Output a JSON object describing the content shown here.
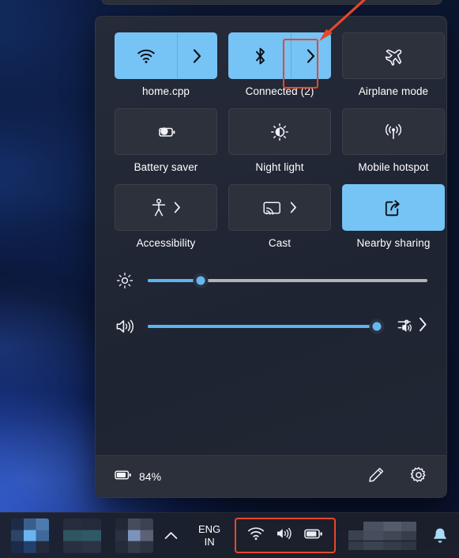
{
  "desktop": {
    "wallpaper_name": "windows-bloom-wallpaper"
  },
  "quick_settings": {
    "tiles": [
      {
        "label": "home.cpp",
        "icon": "wifi-icon",
        "state": "on",
        "has_chevron": true,
        "chevron_style": "split",
        "highlighted": false
      },
      {
        "label": "Connected (2)",
        "icon": "bluetooth-icon",
        "state": "on",
        "has_chevron": true,
        "chevron_style": "split",
        "highlighted": true
      },
      {
        "label": "Airplane mode",
        "icon": "airplane-icon",
        "state": "off",
        "has_chevron": false,
        "chevron_style": "none",
        "highlighted": false
      },
      {
        "label": "Battery saver",
        "icon": "battery-saver-icon",
        "state": "off",
        "has_chevron": false,
        "chevron_style": "none",
        "highlighted": false
      },
      {
        "label": "Night light",
        "icon": "night-light-icon",
        "state": "off",
        "has_chevron": false,
        "chevron_style": "none",
        "highlighted": false
      },
      {
        "label": "Mobile hotspot",
        "icon": "hotspot-icon",
        "state": "off",
        "has_chevron": false,
        "chevron_style": "none",
        "highlighted": false
      },
      {
        "label": "Accessibility",
        "icon": "accessibility-icon",
        "state": "off",
        "has_chevron": true,
        "chevron_style": "inline",
        "highlighted": false
      },
      {
        "label": "Cast",
        "icon": "cast-icon",
        "state": "off",
        "has_chevron": true,
        "chevron_style": "inline",
        "highlighted": false
      },
      {
        "label": "Nearby sharing",
        "icon": "nearby-sharing-icon",
        "state": "on",
        "has_chevron": false,
        "chevron_style": "none",
        "highlighted": false
      }
    ],
    "sliders": [
      {
        "name": "brightness",
        "icon": "brightness-icon",
        "value": 19,
        "min": 0,
        "max": 100,
        "has_end_control": false
      },
      {
        "name": "volume",
        "icon": "volume-icon",
        "value": 97,
        "min": 0,
        "max": 100,
        "has_end_control": true,
        "end_icon": "audio-output-selector-icon"
      }
    ],
    "footer": {
      "battery_icon": "battery-icon",
      "battery_percent": "84%",
      "edit_icon": "pencil-icon",
      "settings_icon": "gear-icon"
    }
  },
  "annotation": {
    "arrow_color": "#e8472a",
    "highlight_color": "#e8472a",
    "target": "bluetooth-chevron-button"
  },
  "taskbar": {
    "app_icons": [
      "blurred-app-1",
      "blurred-app-2",
      "blurred-app-3"
    ],
    "show_hidden_icons": "chevron-up-icon",
    "language": {
      "line1": "ENG",
      "line2": "IN"
    },
    "tray_icons": [
      "wifi-icon",
      "volume-icon",
      "battery-icon"
    ],
    "clock": "blurred-clock",
    "notifications_icon": "bell-icon"
  },
  "colors": {
    "accent": "#76c3f5",
    "tile_off": "#2c313c",
    "panel_bg": "#222836",
    "annotation": "#e8472a"
  }
}
